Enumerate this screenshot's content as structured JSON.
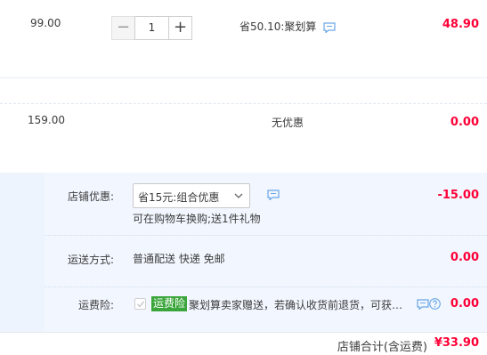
{
  "items": [
    {
      "price": "99.00",
      "quantity": "1",
      "minus_label": "−",
      "plus_label": "+",
      "promo": "省50.10:聚划算",
      "total": "48.90"
    },
    {
      "price": "159.00",
      "promo": "无优惠",
      "total": "0.00"
    }
  ],
  "store": {
    "discount": {
      "label": "店铺优惠:",
      "selected": "省15元:组合优惠",
      "note": "可在购物车换购;送1件礼物",
      "amount": "-15.00"
    },
    "shipping": {
      "label": "运送方式:",
      "value": "普通配送 快递 免邮",
      "amount": "0.00"
    },
    "insurance": {
      "label": "运费险:",
      "tag": "运费险",
      "desc": "聚划算卖家赠送，若确认收货前退货，可获…",
      "amount": "0.00"
    }
  },
  "footer": {
    "label": "店铺合计(含运费)",
    "total": "¥33.90"
  },
  "colors": {
    "accent_red": "#ff0036",
    "store_bg": "#f2f7ff",
    "insurance_green": "#3aa53a",
    "icon_blue": "#6aa6e6"
  }
}
